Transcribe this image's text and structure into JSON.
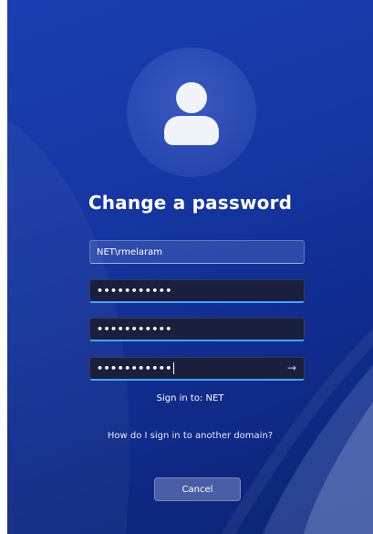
{
  "colors": {
    "background": "#1637a3",
    "field_focus_border": "#4aa3ff"
  },
  "header": {
    "title": "Change a password",
    "avatar_icon": "user-silhouette-icon"
  },
  "form": {
    "username_value": "NET\\rmelaram",
    "old_password_value": "•••••••••••",
    "new_password_value": "•••••••••••",
    "confirm_password_value": "•••••••••••",
    "submit_icon": "arrow-right-icon",
    "submit_glyph": "→"
  },
  "sign_in_to": "Sign in to: NET",
  "help_link": "How do I sign in to another domain?",
  "cancel_label": "Cancel"
}
